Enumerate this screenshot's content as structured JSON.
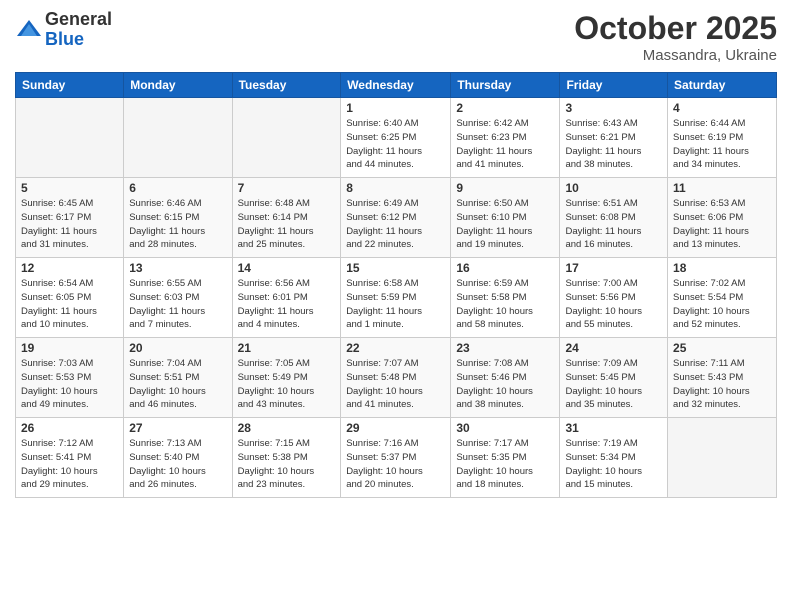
{
  "header": {
    "logo_general": "General",
    "logo_blue": "Blue",
    "month_title": "October 2025",
    "location": "Massandra, Ukraine"
  },
  "weekdays": [
    "Sunday",
    "Monday",
    "Tuesday",
    "Wednesday",
    "Thursday",
    "Friday",
    "Saturday"
  ],
  "weeks": [
    [
      {
        "day": "",
        "info": ""
      },
      {
        "day": "",
        "info": ""
      },
      {
        "day": "",
        "info": ""
      },
      {
        "day": "1",
        "info": "Sunrise: 6:40 AM\nSunset: 6:25 PM\nDaylight: 11 hours\nand 44 minutes."
      },
      {
        "day": "2",
        "info": "Sunrise: 6:42 AM\nSunset: 6:23 PM\nDaylight: 11 hours\nand 41 minutes."
      },
      {
        "day": "3",
        "info": "Sunrise: 6:43 AM\nSunset: 6:21 PM\nDaylight: 11 hours\nand 38 minutes."
      },
      {
        "day": "4",
        "info": "Sunrise: 6:44 AM\nSunset: 6:19 PM\nDaylight: 11 hours\nand 34 minutes."
      }
    ],
    [
      {
        "day": "5",
        "info": "Sunrise: 6:45 AM\nSunset: 6:17 PM\nDaylight: 11 hours\nand 31 minutes."
      },
      {
        "day": "6",
        "info": "Sunrise: 6:46 AM\nSunset: 6:15 PM\nDaylight: 11 hours\nand 28 minutes."
      },
      {
        "day": "7",
        "info": "Sunrise: 6:48 AM\nSunset: 6:14 PM\nDaylight: 11 hours\nand 25 minutes."
      },
      {
        "day": "8",
        "info": "Sunrise: 6:49 AM\nSunset: 6:12 PM\nDaylight: 11 hours\nand 22 minutes."
      },
      {
        "day": "9",
        "info": "Sunrise: 6:50 AM\nSunset: 6:10 PM\nDaylight: 11 hours\nand 19 minutes."
      },
      {
        "day": "10",
        "info": "Sunrise: 6:51 AM\nSunset: 6:08 PM\nDaylight: 11 hours\nand 16 minutes."
      },
      {
        "day": "11",
        "info": "Sunrise: 6:53 AM\nSunset: 6:06 PM\nDaylight: 11 hours\nand 13 minutes."
      }
    ],
    [
      {
        "day": "12",
        "info": "Sunrise: 6:54 AM\nSunset: 6:05 PM\nDaylight: 11 hours\nand 10 minutes."
      },
      {
        "day": "13",
        "info": "Sunrise: 6:55 AM\nSunset: 6:03 PM\nDaylight: 11 hours\nand 7 minutes."
      },
      {
        "day": "14",
        "info": "Sunrise: 6:56 AM\nSunset: 6:01 PM\nDaylight: 11 hours\nand 4 minutes."
      },
      {
        "day": "15",
        "info": "Sunrise: 6:58 AM\nSunset: 5:59 PM\nDaylight: 11 hours\nand 1 minute."
      },
      {
        "day": "16",
        "info": "Sunrise: 6:59 AM\nSunset: 5:58 PM\nDaylight: 10 hours\nand 58 minutes."
      },
      {
        "day": "17",
        "info": "Sunrise: 7:00 AM\nSunset: 5:56 PM\nDaylight: 10 hours\nand 55 minutes."
      },
      {
        "day": "18",
        "info": "Sunrise: 7:02 AM\nSunset: 5:54 PM\nDaylight: 10 hours\nand 52 minutes."
      }
    ],
    [
      {
        "day": "19",
        "info": "Sunrise: 7:03 AM\nSunset: 5:53 PM\nDaylight: 10 hours\nand 49 minutes."
      },
      {
        "day": "20",
        "info": "Sunrise: 7:04 AM\nSunset: 5:51 PM\nDaylight: 10 hours\nand 46 minutes."
      },
      {
        "day": "21",
        "info": "Sunrise: 7:05 AM\nSunset: 5:49 PM\nDaylight: 10 hours\nand 43 minutes."
      },
      {
        "day": "22",
        "info": "Sunrise: 7:07 AM\nSunset: 5:48 PM\nDaylight: 10 hours\nand 41 minutes."
      },
      {
        "day": "23",
        "info": "Sunrise: 7:08 AM\nSunset: 5:46 PM\nDaylight: 10 hours\nand 38 minutes."
      },
      {
        "day": "24",
        "info": "Sunrise: 7:09 AM\nSunset: 5:45 PM\nDaylight: 10 hours\nand 35 minutes."
      },
      {
        "day": "25",
        "info": "Sunrise: 7:11 AM\nSunset: 5:43 PM\nDaylight: 10 hours\nand 32 minutes."
      }
    ],
    [
      {
        "day": "26",
        "info": "Sunrise: 7:12 AM\nSunset: 5:41 PM\nDaylight: 10 hours\nand 29 minutes."
      },
      {
        "day": "27",
        "info": "Sunrise: 7:13 AM\nSunset: 5:40 PM\nDaylight: 10 hours\nand 26 minutes."
      },
      {
        "day": "28",
        "info": "Sunrise: 7:15 AM\nSunset: 5:38 PM\nDaylight: 10 hours\nand 23 minutes."
      },
      {
        "day": "29",
        "info": "Sunrise: 7:16 AM\nSunset: 5:37 PM\nDaylight: 10 hours\nand 20 minutes."
      },
      {
        "day": "30",
        "info": "Sunrise: 7:17 AM\nSunset: 5:35 PM\nDaylight: 10 hours\nand 18 minutes."
      },
      {
        "day": "31",
        "info": "Sunrise: 7:19 AM\nSunset: 5:34 PM\nDaylight: 10 hours\nand 15 minutes."
      },
      {
        "day": "",
        "info": ""
      }
    ]
  ]
}
